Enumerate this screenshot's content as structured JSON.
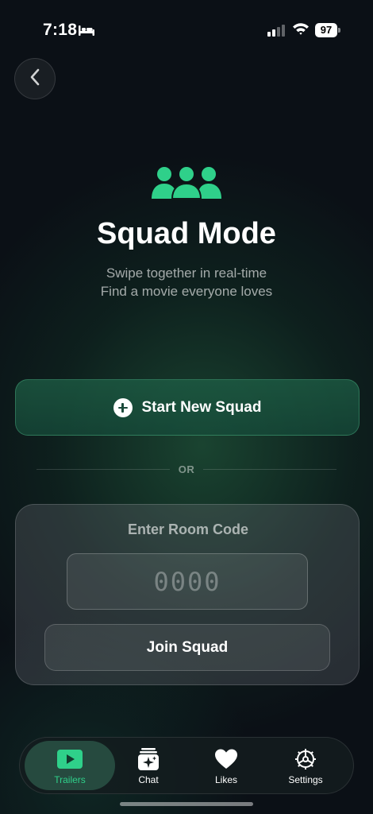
{
  "status_bar": {
    "time": "7:18",
    "battery": "97"
  },
  "header": {
    "back_icon": "chevron-left-icon"
  },
  "hero": {
    "icon": "group-people-icon",
    "title": "Squad Mode",
    "subtitle_line1": "Swipe together in real-time",
    "subtitle_line2": "Find a movie everyone loves"
  },
  "start_squad": {
    "label": "Start New Squad",
    "icon": "plus-circle-icon"
  },
  "divider": {
    "label": "OR"
  },
  "room_code": {
    "title": "Enter Room Code",
    "placeholder": "0000",
    "value": "",
    "join_label": "Join Squad"
  },
  "tabs": [
    {
      "label": "Trailers",
      "icon": "play-icon",
      "active": true
    },
    {
      "label": "Chat",
      "icon": "chat-sparkle-icon",
      "active": false
    },
    {
      "label": "Likes",
      "icon": "heart-icon",
      "active": false
    },
    {
      "label": "Settings",
      "icon": "gear-icon",
      "active": false
    }
  ],
  "colors": {
    "accent": "#2fd08a",
    "background": "#0b1016",
    "button_green": "#1e5f46"
  }
}
